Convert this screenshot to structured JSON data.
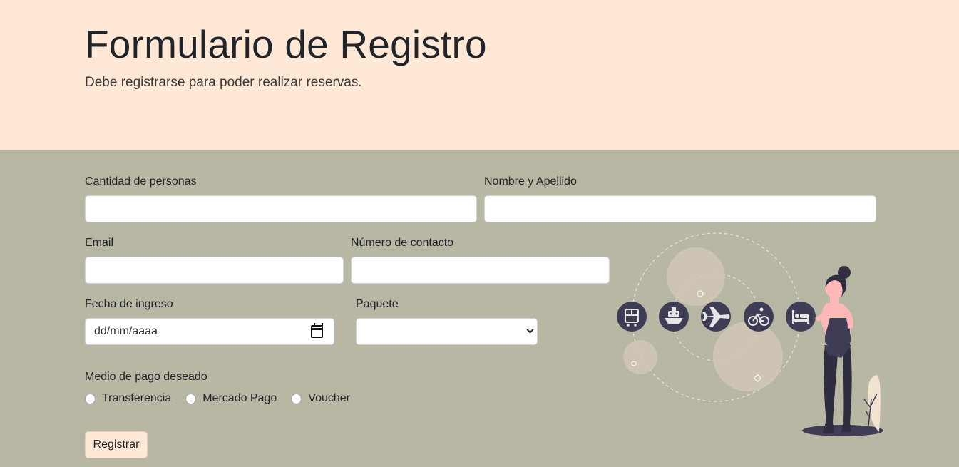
{
  "header": {
    "title": "Formulario de Registro",
    "subtitle": "Debe registrarse para poder realizar reservas."
  },
  "form": {
    "people_label": "Cantidad de personas",
    "people_value": "",
    "name_label": "Nombre y Apellido",
    "name_value": "",
    "email_label": "Email",
    "email_value": "",
    "phone_label": "Número de contacto",
    "phone_value": "",
    "date_label": "Fecha de ingreso",
    "date_placeholder": "dd/mm/aaaa",
    "package_label": "Paquete",
    "package_selected": "",
    "payment_label": "Medio de pago deseado",
    "payment_options": [
      "Transferencia",
      "Mercado Pago",
      "Voucher"
    ],
    "submit_label": "Registrar"
  },
  "colors": {
    "hero_bg": "#ffe8d6",
    "form_bg": "#b7b7a4",
    "button_bg": "#ffe8d6",
    "icon_circle": "#3f3d56",
    "illustration_light": "#d1c7b6"
  },
  "illustration": {
    "icons": [
      "bus-icon",
      "ship-icon",
      "airplane-icon",
      "bicycle-icon",
      "bed-icon"
    ]
  }
}
